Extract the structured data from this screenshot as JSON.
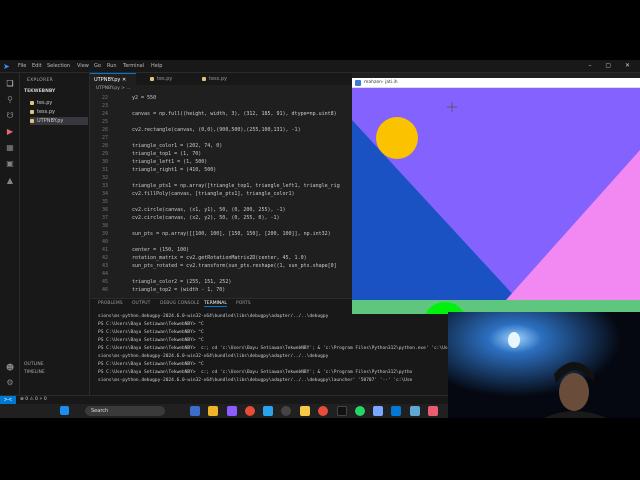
{
  "titlebar": {
    "menus": [
      "File",
      "Edit",
      "Selection",
      "View",
      "Go",
      "Run",
      "Terminal",
      "Help"
    ]
  },
  "sidebar": {
    "title": "EXPLORER",
    "folder": "TEKWEBNBY",
    "files": [
      "tes.py",
      "tess.py",
      "UTPNBY.py"
    ],
    "outline": "OUTLINE",
    "timeline": "TIMELINE"
  },
  "tabs": [
    "UTPNBY.py",
    "tes.py",
    "tess.py"
  ],
  "breadcrumb": "UTPNBY.py > ...",
  "editor": {
    "lines": [
      {
        "n": "22",
        "code": "y2 = 550"
      },
      {
        "n": "23",
        "code": ""
      },
      {
        "n": "24",
        "code": "canvas = np.full((height, width, 3), (312, 185, 91), dtype=np.uint8)"
      },
      {
        "n": "25",
        "code": ""
      },
      {
        "n": "26",
        "code": "cv2.rectangle(canvas, (0,0),(900,500),(255,100,131), -1)"
      },
      {
        "n": "27",
        "code": ""
      },
      {
        "n": "28",
        "code": "triangle_color1 = (202, 74, 0)"
      },
      {
        "n": "29",
        "code": "triangle_top1 = (1, 70)"
      },
      {
        "n": "30",
        "code": "triangle_left1 = (1, 500)"
      },
      {
        "n": "31",
        "code": "triangle_right1 = (410, 500)"
      },
      {
        "n": "32",
        "code": ""
      },
      {
        "n": "33",
        "code": "triangle_pts1 = np.array([triangle_top1, triangle_left1, triangle_rig"
      },
      {
        "n": "34",
        "code": "cv2.fillPoly(canvas, [triangle_pts1], triangle_color1)"
      },
      {
        "n": "35",
        "code": ""
      },
      {
        "n": "36",
        "code": "cv2.circle(canvas, (x1, y1), 50, (0, 200, 255), -1)"
      },
      {
        "n": "37",
        "code": "cv2.circle(canvas, (x2, y2), 50, (0, 255, 0), -1)"
      },
      {
        "n": "38",
        "code": ""
      },
      {
        "n": "39",
        "code": "sun_pts = np.array([[100, 100], [150, 150], [200, 100]], np.int32)"
      },
      {
        "n": "40",
        "code": ""
      },
      {
        "n": "41",
        "code": "center = (150, 100)"
      },
      {
        "n": "42",
        "code": "rotation_matrix = cv2.getRotationMatrix2D(center, 45, 1.0)"
      },
      {
        "n": "43",
        "code": "sun_pts_rotated = cv2.transform(sun_pts.reshape((1, sun_pts.shape[0]"
      },
      {
        "n": "44",
        "code": ""
      },
      {
        "n": "45",
        "code": "triangle_color2 = (255, 151, 252)"
      },
      {
        "n": "46",
        "code": "triangle_top2 = (width - 1, 70)"
      }
    ]
  },
  "panel": {
    "tabs": [
      "PROBLEMS",
      "OUTPUT",
      "DEBUG CONSOLE",
      "TERMINAL",
      "PORTS"
    ],
    "terminal": [
      "sions\\ms-python.debugpy-2024.6.0-win32-x64\\bundled\\libs\\debugpy\\adapter/../..\\debugpy",
      "PS C:\\Users\\Bayu Setiawan\\TekwebNBY> ^C",
      "PS C:\\Users\\Bayu Setiawan\\TekwebNBY> ^C",
      "PS C:\\Users\\Bayu Setiawan\\TekwebNBY> ^C",
      "PS C:\\Users\\Bayu Setiawan\\TekwebNBY>  c:; cd 'c:\\Users\\Bayu Setiawan\\TekwebNBY'; & 'c:\\Program Files\\Python312\\python.exe' 'c:\\Users\\Bayu Setiawan\\.vscode\\extensions\\ms-python.debugpy\\launcher' '50691' '--' 'c:\\Use",
      "sions\\ms-python.debugpy-2024.6.0-win32-x64\\bundled\\libs\\debugpy\\adapter/../..\\debugpy",
      "PS C:\\Users\\Bayu Setiawan\\TekwebNBY> ^C",
      "PS C:\\Users\\Bayu Setiawan\\TekwebNBY>  c:; cd 'c:\\Users\\Bayu Setiawan\\TekwebNBY'; & 'c:\\Program Files\\Python312\\pytho",
      "sions\\ms-python.debugpy-2024.6.0-win32-x64\\bundled\\libs\\debugpy\\adapter/../..\\debugpy\\launcher' '50707' '--' 'c:\\Use"
    ]
  },
  "status": {
    "left": "⊗ 0 ⚠ 0   ⚡ 0"
  },
  "taskbar": {
    "search_label": "Search"
  },
  "cv_window": {
    "title": "mahzen- jati.ih",
    "colors": {
      "background": "#8362fd",
      "triangle_left": "#1b52c3",
      "triangle_right": "#f288f1",
      "ground": "#5fc67e",
      "sun": "#fbc200",
      "green_circle": "#00f20c"
    }
  }
}
